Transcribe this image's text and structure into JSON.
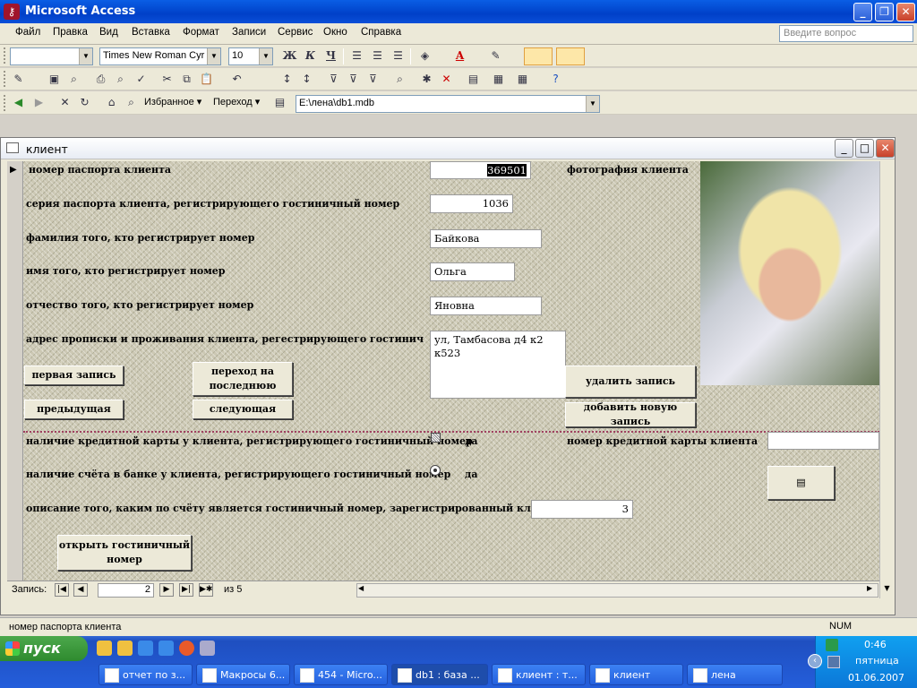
{
  "app": {
    "title": "Microsoft Access",
    "icon": "key-icon"
  },
  "menu": [
    "Файл",
    "Правка",
    "Вид",
    "Вставка",
    "Формат",
    "Записи",
    "Сервис",
    "Окно",
    "Справка"
  ],
  "ask_placeholder": "Введите вопрос",
  "toolbar": {
    "font": "Times New Roman Cyr",
    "size": "10",
    "favorites": "Избранное",
    "goto": "Переход",
    "path": "E:\\лена\\db1.mdb"
  },
  "window": {
    "title": "клиент"
  },
  "form": {
    "labels": {
      "passport": "номер паспорта клиента",
      "photo": "фотография клиента",
      "series": "серия паспорта клиента, регистрирующего гостиничный номер",
      "surname": "фамилия того, кто регистрирует номер",
      "name": "имя того, кто регистрирует номер",
      "patronymic": "отчество того, кто регистрирует номер",
      "address": "адрес прописки и проживания клиента, регестрирующего гостинич",
      "card": "наличие кредитной карты у клиента, регистрирующего гостиничный номер",
      "card_yes": "да",
      "card_number": "номер кредитной карты клиента",
      "account": "наличие счёта в банке у клиента, регистрирующего гостиничный номер",
      "account_yes": "да",
      "description": "описание того, каким по счёту является гостиничный номер, зарегистрированный клиентом"
    },
    "values": {
      "passport": "369501",
      "series": "1036",
      "surname": "Байкова",
      "name": "Ольга",
      "patronymic": "Яновна",
      "address": "ул, Тамбасова д4 к2 к523",
      "card_number": "",
      "description": "3"
    },
    "buttons": {
      "first": "первая запись",
      "last": "переход на последнюю",
      "prev": "предыдущая",
      "next": "следующая",
      "delete": "удалить запись",
      "add": "добавить новую запись",
      "open_room": "открыть гостиничный номер"
    }
  },
  "nav": {
    "label": "Запись:",
    "current": "2",
    "of": "из  5"
  },
  "status": {
    "text": "номер паспорта клиента",
    "mode": "NUM"
  },
  "taskbar": {
    "start": "пуск",
    "tasks": [
      "отчет по з...",
      "Макросы 6...",
      "454 - Micro...",
      "db1 : база ...",
      "клиент : т...",
      "клиент",
      "лена"
    ],
    "time": "0:46",
    "day": "пятница",
    "date": "01.06.2007"
  }
}
